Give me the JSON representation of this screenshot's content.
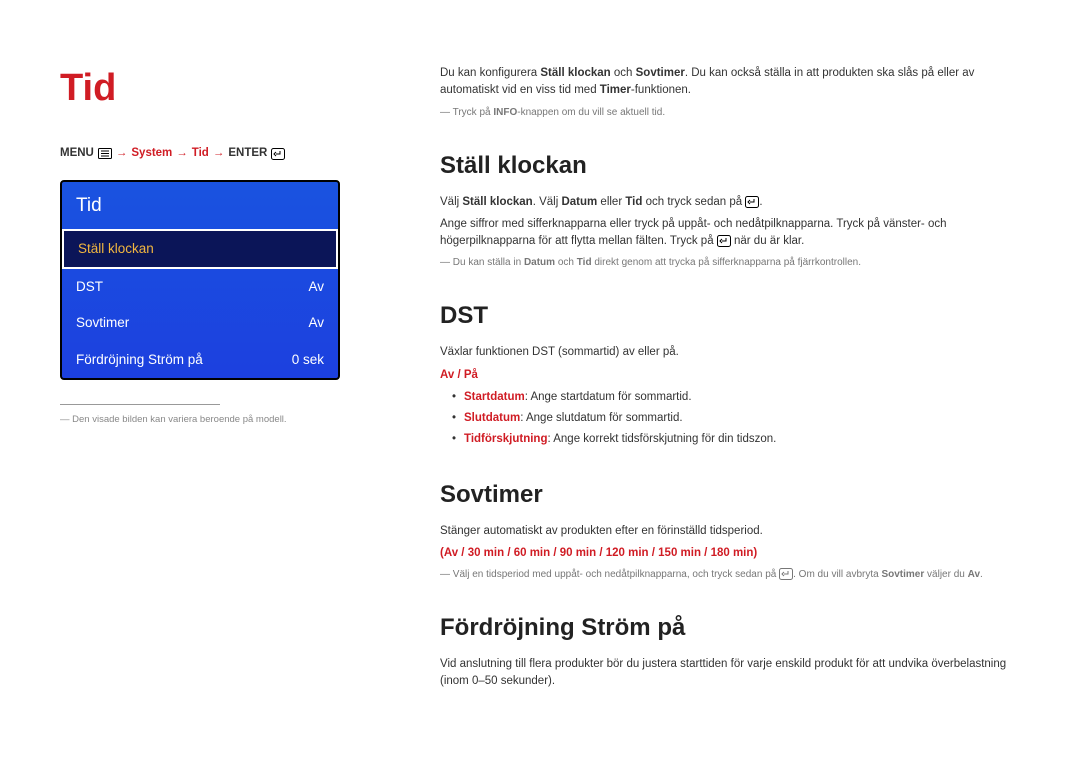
{
  "page_title": "Tid",
  "breadcrumb": {
    "menu": "MENU",
    "arrow": " → ",
    "system": "System",
    "tid": "Tid",
    "enter": "ENTER"
  },
  "panel": {
    "title": "Tid",
    "rows": [
      {
        "label": "Ställ klockan",
        "value": ""
      },
      {
        "label": "DST",
        "value": "Av"
      },
      {
        "label": "Sovtimer",
        "value": "Av"
      },
      {
        "label": "Fördröjning Ström på",
        "value": "0 sek"
      }
    ]
  },
  "panel_footnote": "Den visade bilden kan variera beroende på modell.",
  "intro": {
    "p1a": "Du kan konfigurera ",
    "p1b": "Ställ klockan",
    "p1c": " och ",
    "p1d": "Sovtimer",
    "p1e": ". Du kan också ställa in att produkten ska slås på eller av automatiskt vid en viss tid med ",
    "p1f": "Timer",
    "p1g": "-funktionen.",
    "note_a": "Tryck på ",
    "note_b": "INFO",
    "note_c": "-knappen om du vill se aktuell tid."
  },
  "sec1": {
    "title": "Ställ klockan",
    "p1a": "Välj ",
    "p1b": "Ställ klockan",
    "p1c": ". Välj ",
    "p1d": "Datum",
    "p1e": " eller ",
    "p1f": "Tid",
    "p1g": " och tryck sedan på ",
    "p1h": ".",
    "p2": "Ange siffror med sifferknapparna eller tryck på uppåt- och nedåtpilknapparna. Tryck på vänster- och högerpilknapparna för att flytta mellan fälten. Tryck på ",
    "p2b": " när du är klar.",
    "note_a": "Du kan ställa in ",
    "note_b": "Datum",
    "note_c": " och ",
    "note_d": "Tid",
    "note_e": " direkt genom att trycka på sifferknapparna på fjärrkontrollen."
  },
  "sec2": {
    "title": "DST",
    "p1": "Växlar funktionen DST (sommartid) av eller på.",
    "opts": "Av / På",
    "bullets": [
      {
        "label": "Startdatum",
        "text": ": Ange startdatum för sommartid."
      },
      {
        "label": "Slutdatum",
        "text": ": Ange slutdatum för sommartid."
      },
      {
        "label": "Tidförskjutning",
        "text": ": Ange korrekt tidsförskjutning för din tidszon."
      }
    ]
  },
  "sec3": {
    "title": "Sovtimer",
    "p1": "Stänger automatiskt av produkten efter en förinställd tidsperiod.",
    "opts": "(Av / 30 min / 60 min / 90 min / 120 min / 150 min / 180 min)",
    "note_a": "Välj en tidsperiod med uppåt- och nedåtpilknapparna, och tryck sedan på ",
    "note_b": ". Om du vill avbryta ",
    "note_c": "Sovtimer",
    "note_d": " väljer du ",
    "note_e": "Av",
    "note_f": "."
  },
  "sec4": {
    "title": "Fördröjning Ström på",
    "p1": "Vid anslutning till flera produkter bör du justera starttiden för varje enskild produkt för att undvika överbelastning (inom 0–50 sekunder)."
  }
}
